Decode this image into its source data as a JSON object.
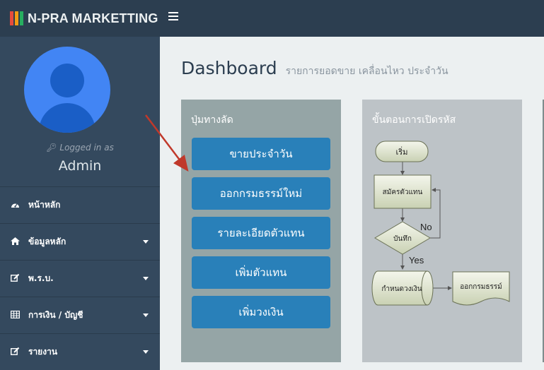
{
  "app": {
    "brand": "N-PRA MARKETTING",
    "brand_colors": [
      "#e74c3c",
      "#f39c12",
      "#27ae60"
    ]
  },
  "user": {
    "logged_in_label": "Logged in as",
    "name": "Admin"
  },
  "sidebar": {
    "items": [
      {
        "label": "หน้าหลัก",
        "icon": "dashboard-icon",
        "has_submenu": false
      },
      {
        "label": "ข้อมูลหลัก",
        "icon": "home-icon",
        "has_submenu": true
      },
      {
        "label": "พ.ร.บ.",
        "icon": "edit-icon",
        "has_submenu": true
      },
      {
        "label": "การเงิน / บัญชี",
        "icon": "table-icon",
        "has_submenu": true
      },
      {
        "label": "รายงาน",
        "icon": "edit-icon",
        "has_submenu": true
      }
    ]
  },
  "header": {
    "title": "Dashboard",
    "subtitle": "รายการยอดขาย เคลื่อนไหว ประจำวัน"
  },
  "shortcuts": {
    "title": "ปุ่มทางลัด",
    "buttons": [
      "ขายประจำวัน",
      "ออกกรมธรรม์ใหม่",
      "รายละเอียดตัวแทน",
      "เพิ่มตัวแทน",
      "เพิ่มวงเงิน"
    ]
  },
  "flowchart": {
    "title": "ขั้นตอนการเปิดรหัส",
    "nodes": {
      "start": "เริ่ม",
      "apply": "สมัครตัวแทน",
      "save": "บันทึก",
      "limit": "กำหนดวงเงิน",
      "policy": "ออกกรมธรรม์"
    },
    "edges": {
      "no": "No",
      "yes": "Yes"
    }
  },
  "colors": {
    "topbar": "#2c3e50",
    "sidebar": "#34495e",
    "accent_button": "#2980b9",
    "annotation_arrow": "#c0392b"
  }
}
